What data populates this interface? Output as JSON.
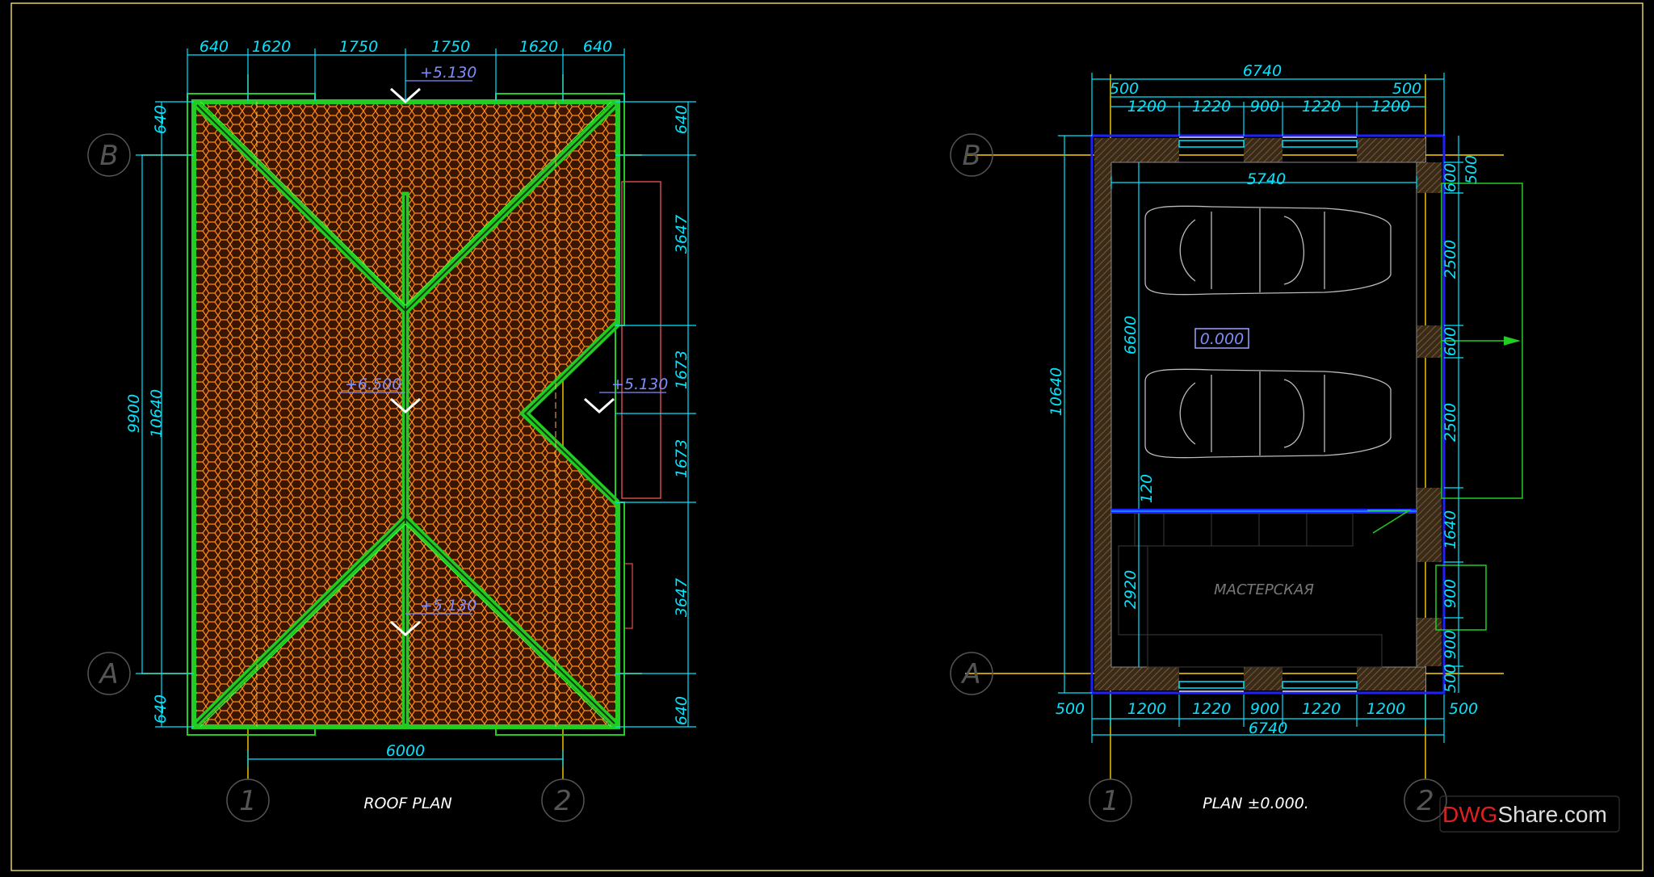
{
  "roof_plan": {
    "title": "ROOF  PLAN",
    "top_dims": [
      "640",
      "1620",
      "1750",
      "1750",
      "1620",
      "640"
    ],
    "left_dims": [
      "640",
      "9900",
      "10640",
      "640"
    ],
    "right_dims": [
      "640",
      "3647",
      "1673",
      "1673",
      "3647",
      "640"
    ],
    "bottom_dim": "6000",
    "elevations": [
      "+5.130",
      "+6.500",
      "+5.130",
      "+5.130"
    ],
    "axes": [
      "B",
      "A",
      "1",
      "2"
    ]
  },
  "floor_plan": {
    "title": "PLAN  ±0.000.",
    "top_dims": [
      "6740",
      "500",
      "500",
      "1200",
      "1220",
      "900",
      "1220",
      "1200",
      "5740"
    ],
    "left_dims": [
      "10640",
      "6600",
      "120",
      "2920"
    ],
    "right_dims": [
      "600",
      "500",
      "2500",
      "600",
      "2500",
      "1640",
      "900",
      "900",
      "500"
    ],
    "bottom_dims": [
      "500",
      "1200",
      "1220",
      "900",
      "1220",
      "1200",
      "500",
      "6740"
    ],
    "floor_level": "0.000",
    "room_label": "МАСТЕРСКАЯ",
    "axes": [
      "B",
      "A",
      "1",
      "2"
    ]
  },
  "watermark": {
    "part1": "DWG",
    "part2": "Share.com",
    "color1": "#e02020",
    "color2": "#dddddd"
  },
  "colors": {
    "dimension": "#00e5ff",
    "ridge": "#22cc22",
    "tiles": "#ff8a1a",
    "axis_line": "#ffd000",
    "wall": "#2020ff",
    "frame": "#e0d060"
  }
}
